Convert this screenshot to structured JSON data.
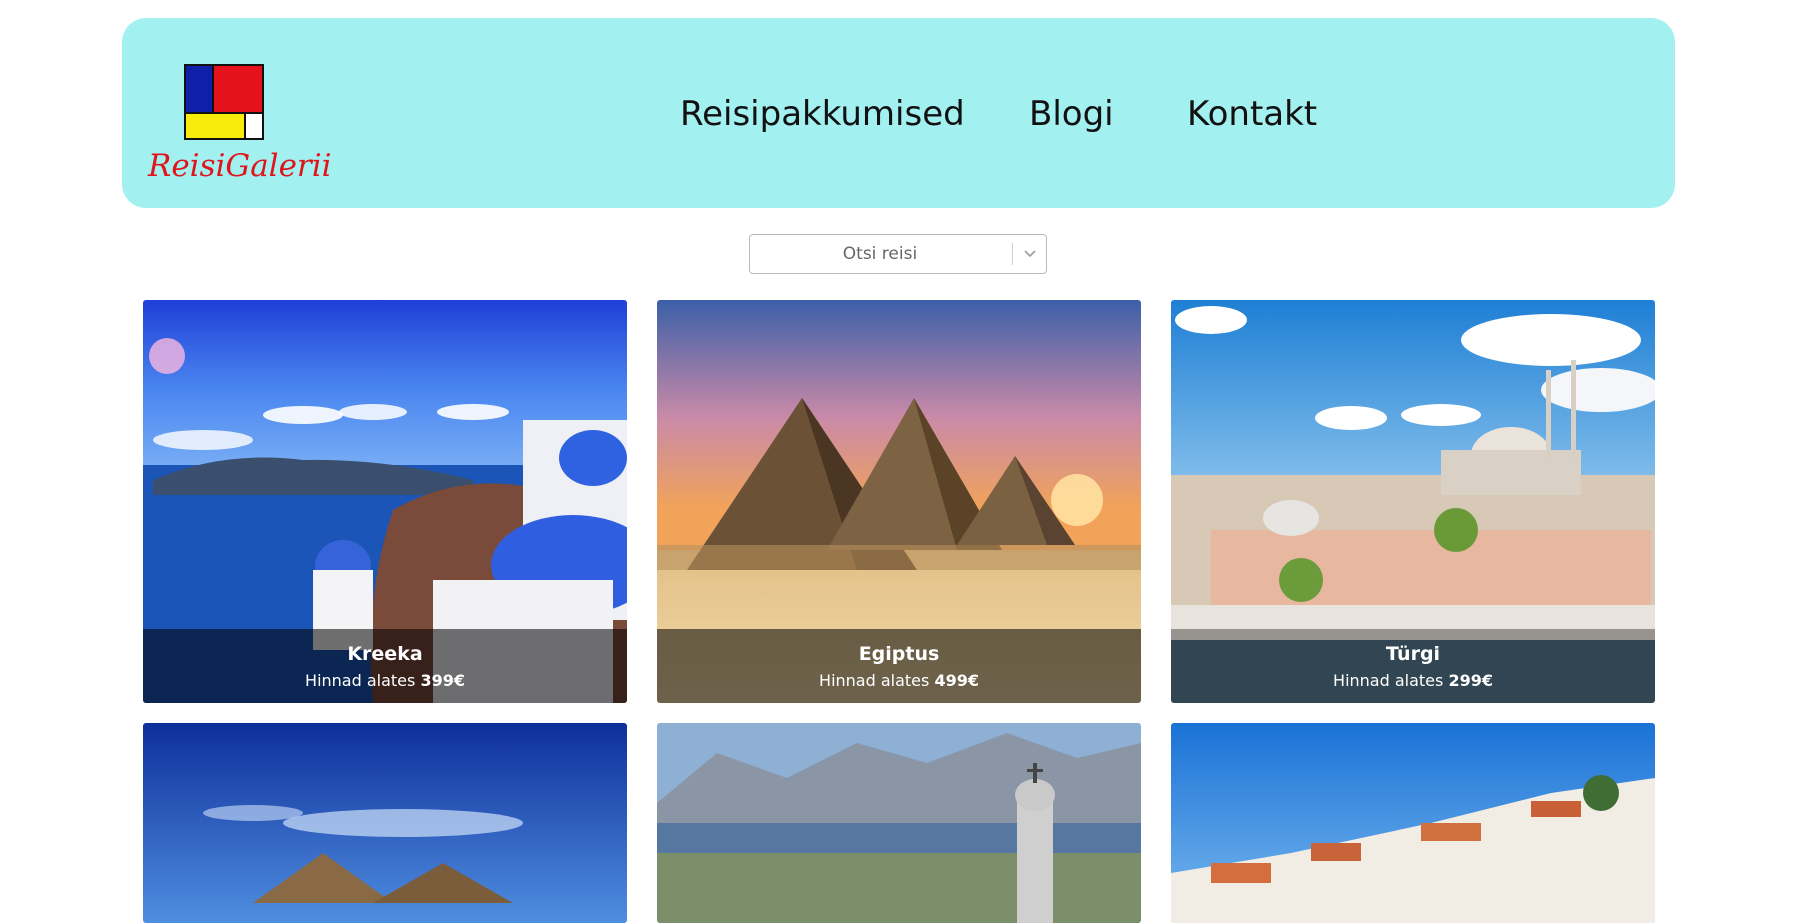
{
  "header": {
    "logo_text": "ReisiGalerii",
    "nav": [
      {
        "label": "Reisipakkumised"
      },
      {
        "label": "Blogi"
      },
      {
        "label": "Kontakt"
      }
    ],
    "bg_color": "#a3f0f1"
  },
  "search": {
    "placeholder": "Otsi reisi",
    "icon": "chevron-down-icon"
  },
  "cards": [
    {
      "title": "Kreeka",
      "price_prefix": "Hinnad alates",
      "price": "399€"
    },
    {
      "title": "Egiptus",
      "price_prefix": "Hinnad alates",
      "price": "499€"
    },
    {
      "title": "Türgi",
      "price_prefix": "Hinnad alates",
      "price": "299€"
    }
  ]
}
